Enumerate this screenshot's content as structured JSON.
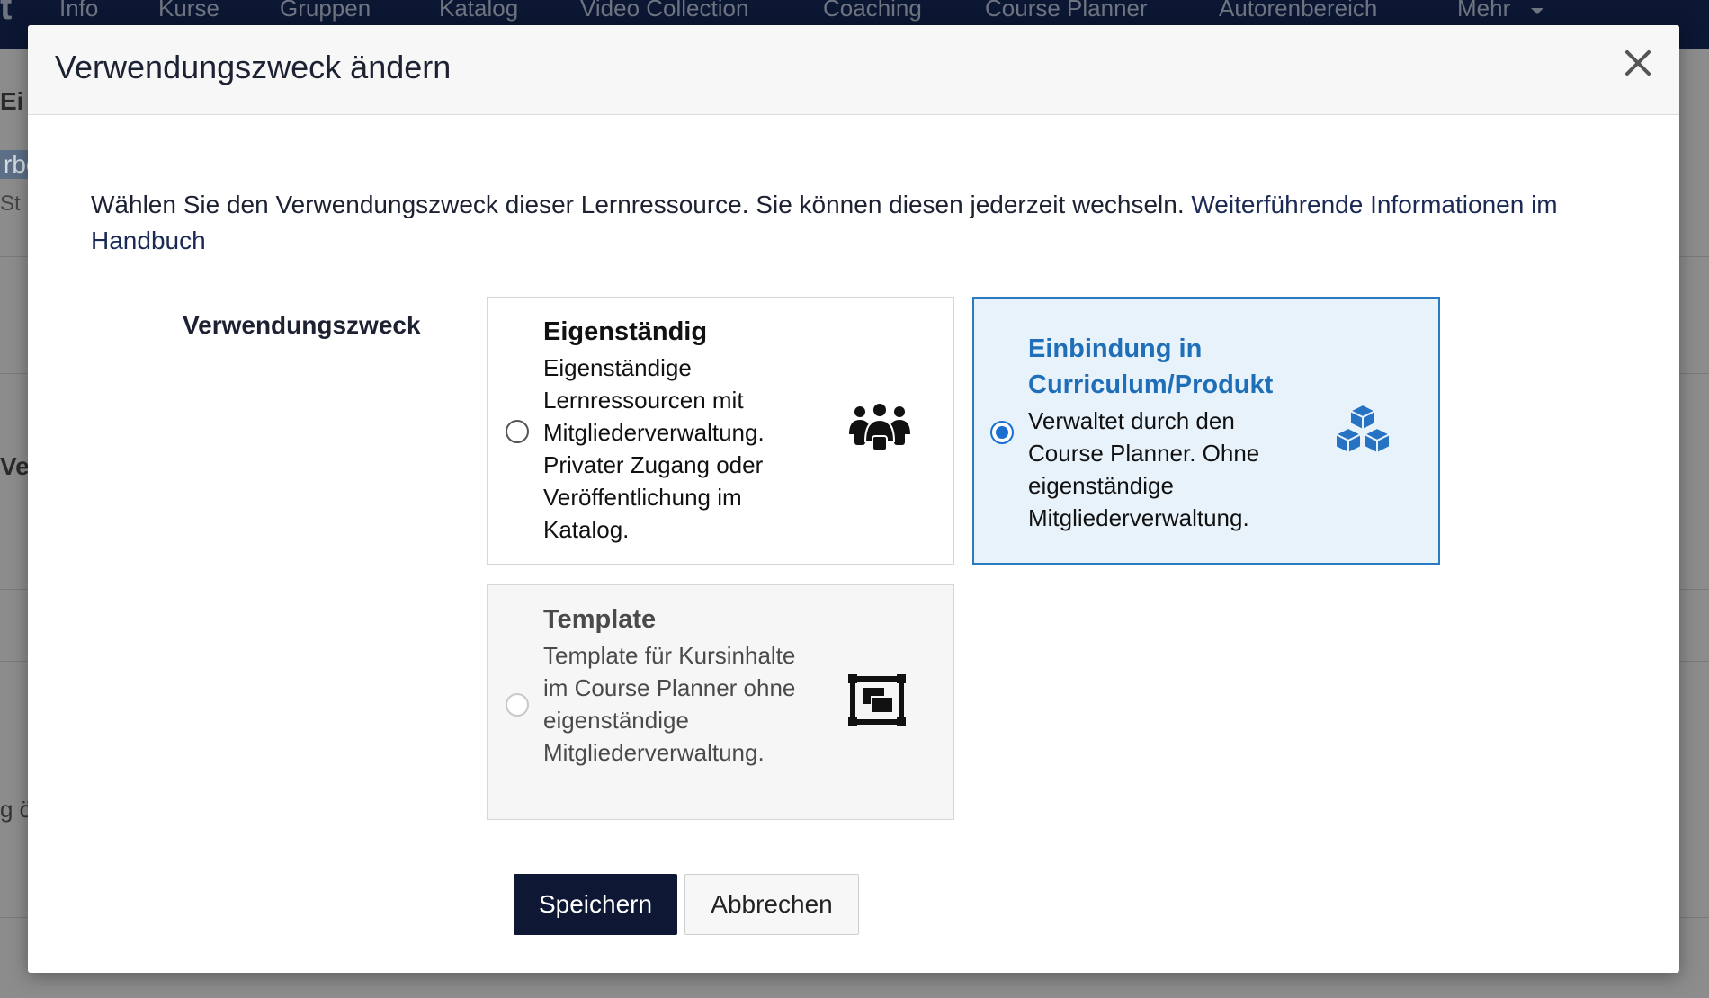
{
  "nav": {
    "logo": "t",
    "items": [
      "Info",
      "Kurse",
      "Gruppen",
      "Katalog",
      "Video Collection",
      "Coaching",
      "Course Planner",
      "Autorenbereich",
      "Mehr"
    ]
  },
  "background": {
    "fragments": [
      "Ei",
      "rbe",
      "St",
      "Ve",
      "g ö"
    ]
  },
  "modal": {
    "title": "Verwendungszweck ändern",
    "close_label": "×",
    "intro_text": "Wählen Sie den Verwendungszweck dieser Lernressource. Sie können diesen jederzeit wechseln. ",
    "intro_link": "Weiterführende Informationen im Handbuch",
    "field_label": "Verwendungszweck",
    "options": [
      {
        "title": "Eigenständig",
        "description": "Eigenständige Lernressourcen mit Mitgliederverwaltung. Privater Zugang oder Veröffentlichung im Katalog.",
        "icon": "users-icon",
        "selected": false,
        "disabled": false
      },
      {
        "title": "Einbindung in Curriculum/Produkt",
        "description": "Verwaltet durch den Course Planner. Ohne eigenständige Mitgliederverwaltung.",
        "icon": "cubes-icon",
        "selected": true,
        "disabled": false
      },
      {
        "title": "Template",
        "description": "Template für Kursinhalte im Course Planner ohne eigenständige Mitgliederverwaltung.",
        "icon": "template-icon",
        "selected": false,
        "disabled": true
      }
    ],
    "save_label": "Speichern",
    "cancel_label": "Abbrechen"
  },
  "colors": {
    "nav_bg": "#0b1733",
    "selected_bg": "#e8f2fb",
    "selected_border": "#2a7ac0",
    "selected_title": "#1f6fb8",
    "primary_button": "#0e1733",
    "radio_checked": "#1a6fd1"
  }
}
